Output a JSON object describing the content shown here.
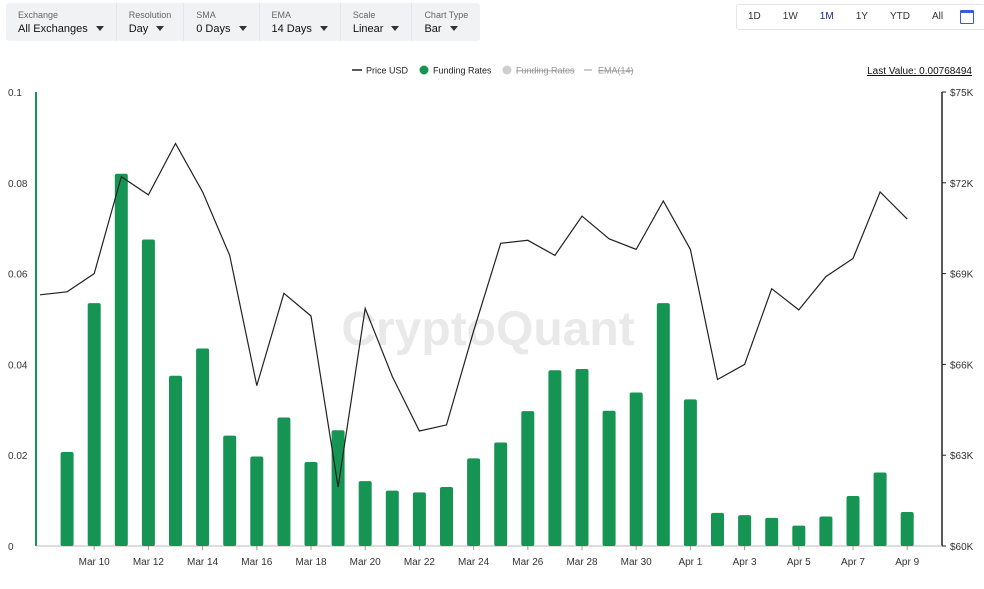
{
  "filters": [
    {
      "label": "Exchange",
      "value": "All Exchanges"
    },
    {
      "label": "Resolution",
      "value": "Day"
    },
    {
      "label": "SMA",
      "value": "0 Days"
    },
    {
      "label": "EMA",
      "value": "14 Days"
    },
    {
      "label": "Scale",
      "value": "Linear"
    },
    {
      "label": "Chart Type",
      "value": "Bar"
    }
  ],
  "ranges": [
    "1D",
    "1W",
    "1M",
    "1Y",
    "YTD",
    "All"
  ],
  "active_range": "1M",
  "last_value": "Last Value: 0.00768494",
  "watermark": "CryptoQuant",
  "colors": {
    "bar": "#169454",
    "price": "#222222",
    "accent": "#1a2a8c"
  },
  "chart_data": {
    "type": "bar",
    "legend": [
      {
        "name": "Price USD",
        "active": true
      },
      {
        "name": "Funding Rates",
        "active": true
      },
      {
        "name": "Funding Rates",
        "active": false
      },
      {
        "name": "EMA(14)",
        "active": false
      }
    ],
    "legend_position": "top-center",
    "x_ticks": [
      "Mar 10",
      "Mar 12",
      "Mar 14",
      "Mar 16",
      "Mar 18",
      "Mar 20",
      "Mar 22",
      "Mar 24",
      "Mar 26",
      "Mar 28",
      "Mar 30",
      "Apr 1",
      "Apr 3",
      "Apr 5",
      "Apr 7",
      "Apr 9"
    ],
    "categories": [
      "Mar 9",
      "Mar 10",
      "Mar 11",
      "Mar 12",
      "Mar 13",
      "Mar 14",
      "Mar 15",
      "Mar 16",
      "Mar 17",
      "Mar 18",
      "Mar 19",
      "Mar 20",
      "Mar 21",
      "Mar 22",
      "Mar 23",
      "Mar 24",
      "Mar 25",
      "Mar 26",
      "Mar 27",
      "Mar 28",
      "Mar 29",
      "Mar 30",
      "Mar 31",
      "Apr 1",
      "Apr 2",
      "Apr 3",
      "Apr 4",
      "Apr 5",
      "Apr 6",
      "Apr 7",
      "Apr 8",
      "Apr 9"
    ],
    "series": [
      {
        "name": "Funding Rates",
        "axis": "left",
        "type": "bar",
        "values": [
          0.0207,
          0.0535,
          0.082,
          0.0675,
          0.0375,
          0.0435,
          0.0243,
          0.0197,
          0.0283,
          0.0185,
          0.0255,
          0.0143,
          0.0122,
          0.0118,
          0.013,
          0.0193,
          0.0228,
          0.0297,
          0.0387,
          0.039,
          0.0298,
          0.0338,
          0.0535,
          0.0323,
          0.0073,
          0.0068,
          0.0062,
          0.0045,
          0.0065,
          0.011,
          0.0162,
          0.0075
        ]
      },
      {
        "name": "Price USD",
        "axis": "right",
        "type": "line",
        "x": [
          "Mar 8",
          "Mar 9",
          "Mar 10",
          "Mar 11",
          "Mar 12",
          "Mar 13",
          "Mar 14",
          "Mar 15",
          "Mar 16",
          "Mar 17",
          "Mar 18",
          "Mar 19",
          "Mar 20",
          "Mar 21",
          "Mar 22",
          "Mar 23",
          "Mar 24",
          "Mar 25",
          "Mar 26",
          "Mar 27",
          "Mar 28",
          "Mar 29",
          "Mar 30",
          "Mar 31",
          "Apr 1",
          "Apr 2",
          "Apr 3",
          "Apr 4",
          "Apr 5",
          "Apr 6",
          "Apr 7",
          "Apr 8",
          "Apr 9"
        ],
        "values": [
          68300,
          68400,
          69000,
          72200,
          71600,
          73300,
          71700,
          69600,
          65300,
          68350,
          67600,
          61950,
          67850,
          65600,
          63800,
          64000,
          67100,
          70000,
          70100,
          69600,
          70900,
          70150,
          69800,
          71400,
          69800,
          65500,
          66000,
          68500,
          67800,
          68900,
          69500,
          71700,
          70800
        ]
      }
    ],
    "ylim_left": [
      0,
      0.1
    ],
    "yticks_left": [
      "0",
      "0.02",
      "0.04",
      "0.06",
      "0.08",
      "0.1"
    ],
    "ylim_right": [
      60000,
      75000
    ],
    "yticks_right": [
      "$60K",
      "$63K",
      "$66K",
      "$69K",
      "$72K",
      "$75K"
    ],
    "grid": false
  }
}
